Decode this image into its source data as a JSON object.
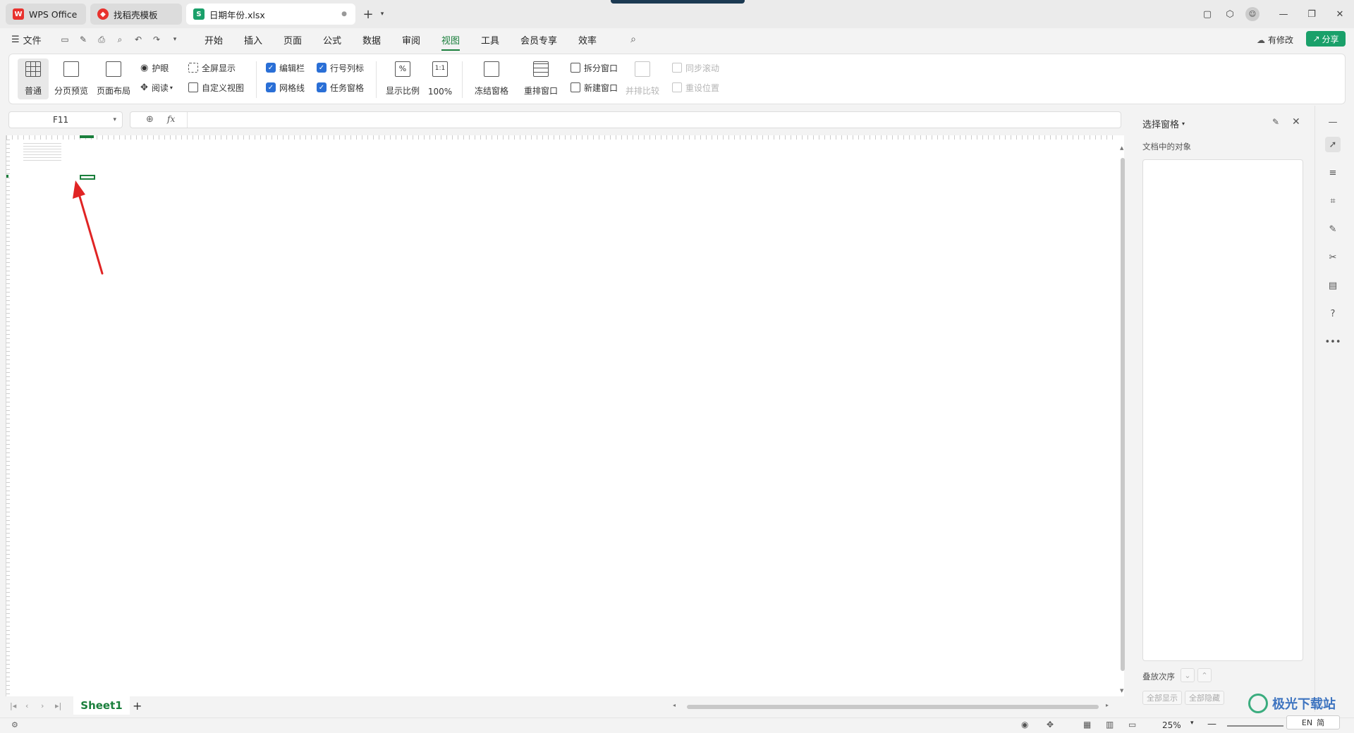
{
  "titlebar": {
    "tabs": [
      {
        "label": "WPS Office",
        "icon": "wps-logo-icon"
      },
      {
        "label": "找稻壳模板",
        "icon": "docer-icon"
      },
      {
        "label": "日期年份.xlsx",
        "icon": "spreadsheet-icon"
      }
    ],
    "new_tab": "+"
  },
  "menu": {
    "file": "文件",
    "items": [
      "开始",
      "插入",
      "页面",
      "公式",
      "数据",
      "审阅",
      "视图",
      "工具",
      "会员专享",
      "效率"
    ],
    "active": "视图",
    "unsaved": "有修改",
    "share": "分享"
  },
  "ribbon": {
    "normal": "普通",
    "page_break": "分页预览",
    "page_layout": "页面布局",
    "eye": "护眼",
    "reading": "阅读",
    "fullscreen": "全屏显示",
    "custom_view": "自定义视图",
    "edit_bar": "编辑栏",
    "row_col": "行号列标",
    "gridlines": "网格线",
    "task_pane": "任务窗格",
    "zoom_ratio": "显示比例",
    "zoom_100": "100%",
    "zoom_100_icon": "1:1",
    "freeze": "冻结窗格",
    "arrange": "重排窗口",
    "split": "拆分窗口",
    "new_window": "新建窗口",
    "side_by_side": "并排比较",
    "sync_scroll": "同步滚动",
    "reset_pos": "重设位置"
  },
  "formula": {
    "cell_ref": "F11",
    "fx": "fx",
    "value": ""
  },
  "sheet": {
    "tab": "Sheet1",
    "add": "+"
  },
  "pane": {
    "title": "选择窗格",
    "subtitle": "文档中的对象",
    "order": "叠放次序",
    "show_all": "全部显示",
    "hide_all": "全部隐藏"
  },
  "status": {
    "zoom": "25%",
    "ime": "EN",
    "ime2": "简"
  },
  "watermark": "极光下载站",
  "colors": {
    "accent": "#1a7f3c",
    "arrow": "#e02424",
    "share": "#1aa06a"
  }
}
